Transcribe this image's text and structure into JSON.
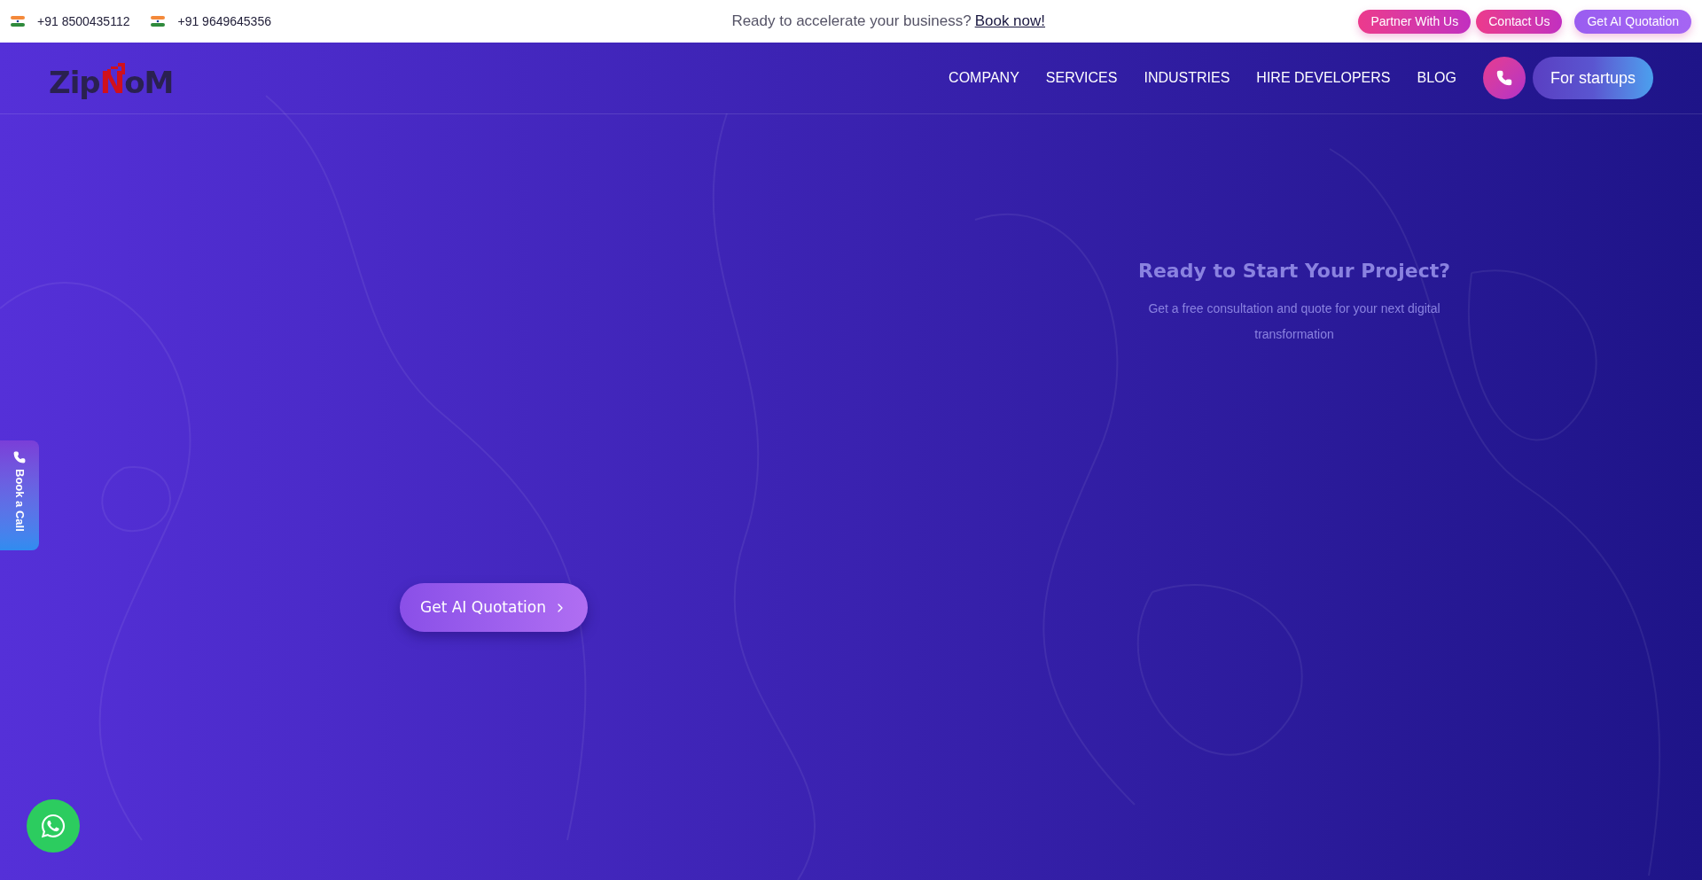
{
  "top_bar": {
    "phones": [
      "+91 8500435112",
      "+91 9649645356"
    ],
    "promo": {
      "text": "Ready to accelerate your business?",
      "link": "Book now!"
    },
    "buttons": [
      {
        "label": "Partner With Us",
        "kind": "pink"
      },
      {
        "label": "Contact Us",
        "kind": "pink"
      },
      {
        "label": "Get AI Quotation",
        "kind": "violet"
      }
    ]
  },
  "nav": {
    "logo": [
      {
        "text": "Zip",
        "kind": "dark"
      },
      {
        "text": "N",
        "kind": "accent"
      },
      {
        "text": "oM",
        "kind": "dark"
      }
    ],
    "items": [
      "COMPANY",
      "SERVICES",
      "INDUSTRIES",
      "HIRE DEVELOPERS",
      "BLOG"
    ],
    "cta": "For startups"
  },
  "hero": {
    "button": "Get AI Quotation",
    "card": {
      "title": "Ready to Start Your Project?",
      "text": "Get a free consultation and quote for your next digital transformation"
    }
  },
  "side_tab": "Book a Call"
}
